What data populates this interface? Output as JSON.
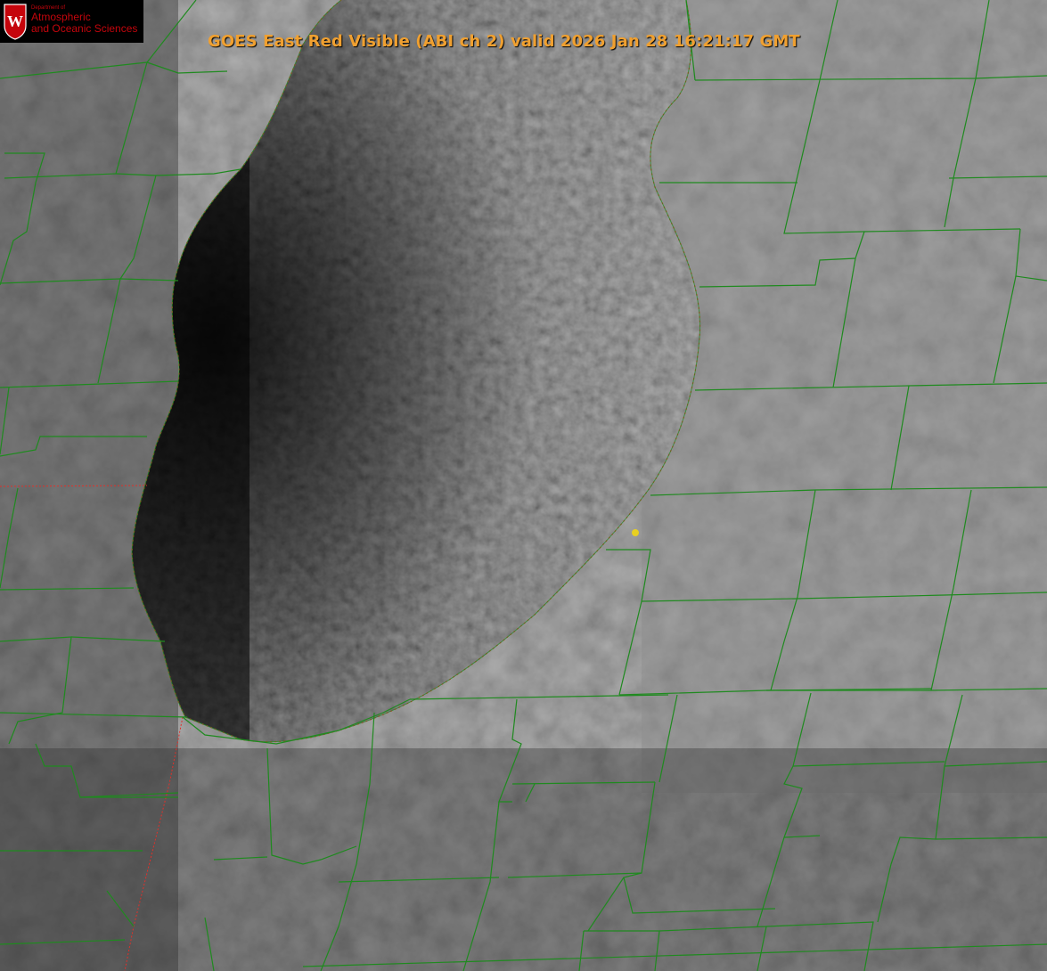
{
  "title": "GOES East Red Visible (ABI ch 2) valid 2026 Jan 28 16:21:17 GMT",
  "logo": {
    "department": "Department of",
    "line1": "Atmospheric",
    "line2": "and Oceanic Sciences",
    "crest_letter": "W",
    "icon": "uw-crest-icon"
  },
  "colors": {
    "title": "#f0a030",
    "county_lines": "#1f8a1f",
    "shoreline": "#e0302a",
    "marker": "#e8d020",
    "land": "#7a7a7a",
    "lake": "#101010",
    "logo_red": "#c5050c"
  }
}
